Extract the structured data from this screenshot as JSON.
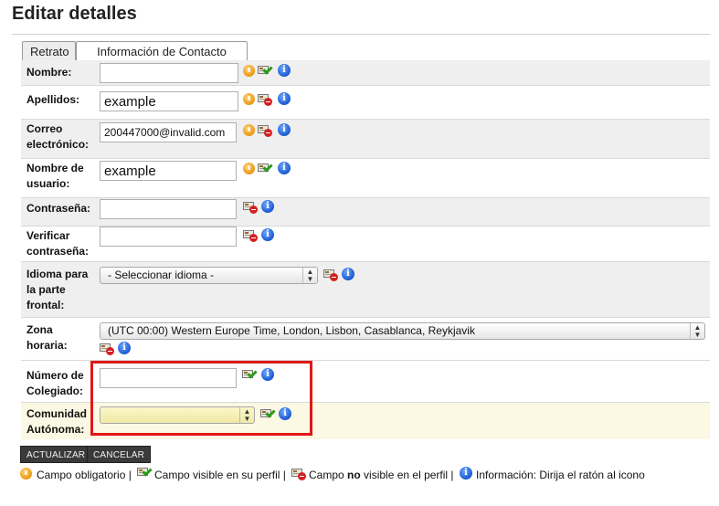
{
  "page_title": "Editar detalles",
  "tabs": [
    {
      "label": "Retrato",
      "active": false
    },
    {
      "label": "Información de Contacto",
      "active": true
    }
  ],
  "fields": {
    "nombre": {
      "label": "Nombre:",
      "value": ""
    },
    "apellidos": {
      "label": "Apellidos:",
      "value": "example"
    },
    "correo": {
      "label1": "Correo",
      "label2": "electrónico:",
      "value": "200447000@invalid.com"
    },
    "usuario": {
      "label1": "Nombre de",
      "label2": "usuario:",
      "value": "example"
    },
    "contrasena": {
      "label": "Contraseña:",
      "value": ""
    },
    "verificar": {
      "label1": "Verificar",
      "label2": "contraseña:",
      "value": ""
    },
    "idioma": {
      "label1": "Idioma para",
      "label2": "la parte",
      "label3": "frontal:",
      "value": "- Seleccionar idioma -"
    },
    "zona": {
      "label1": "Zona",
      "label2": "horaria:",
      "value": "(UTC 00:00) Western Europe Time, London, Lisbon, Casablanca, Reykjavik"
    },
    "colegiado": {
      "label1": "Número de",
      "label2": "Colegiado:",
      "value": ""
    },
    "comunidad": {
      "label1": "Comunidad",
      "label2": "Autónoma:",
      "value": ""
    }
  },
  "buttons": {
    "actualizar": "ACTUALIZAR",
    "cancelar": "CANCELAR"
  },
  "legend": {
    "required": "Campo obligatorio |",
    "visible": "Campo visible en su perfil |",
    "not_visible_pre": "Campo",
    "not_visible_bold": "no",
    "not_visible_post": "visible en el perfil |",
    "info": "Información: Dirija el ratón al icono"
  },
  "icons": {
    "required": "required-field-icon",
    "visible": "visible-profile-icon",
    "not_visible": "not-visible-profile-icon",
    "info": "info-icon"
  },
  "colors": {
    "highlight_border": "#e01818",
    "required_icon": "#f0a020",
    "info_icon": "#1f5fd4",
    "button_bg": "#3a3a3a"
  }
}
